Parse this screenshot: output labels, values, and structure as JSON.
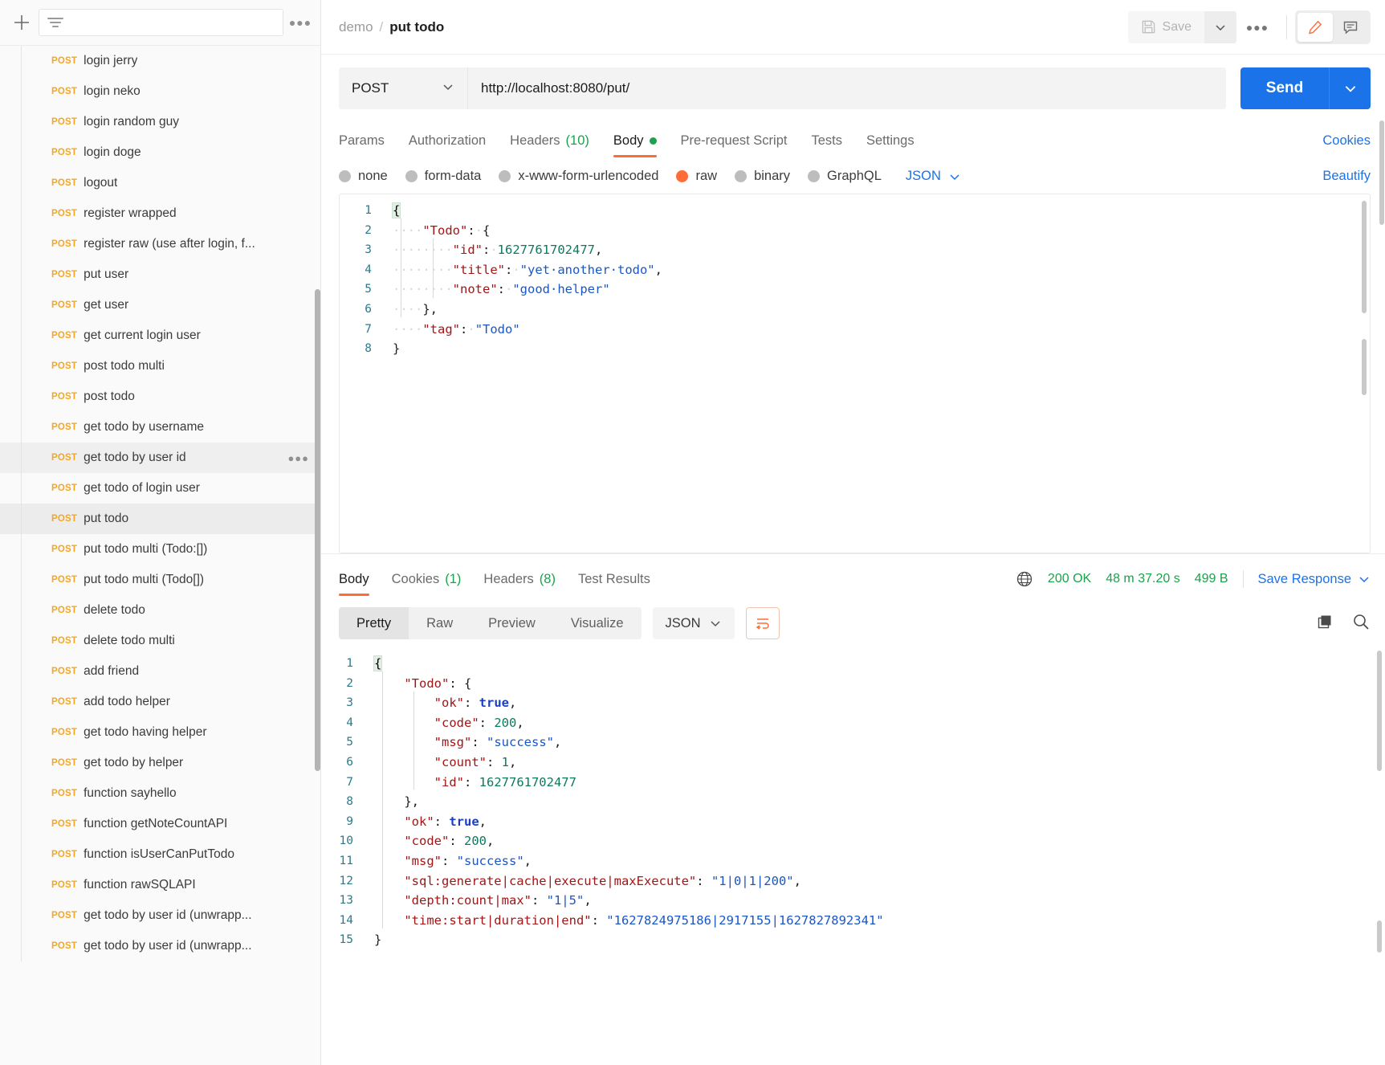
{
  "sidebar": {
    "add_label": "+",
    "filter_placeholder": "",
    "more_label": "●●●",
    "items": [
      {
        "method": "POST",
        "label": "login jerry",
        "state": "normal"
      },
      {
        "method": "POST",
        "label": "login neko",
        "state": "normal"
      },
      {
        "method": "POST",
        "label": "login random guy",
        "state": "normal"
      },
      {
        "method": "POST",
        "label": "login doge",
        "state": "normal"
      },
      {
        "method": "POST",
        "label": "logout",
        "state": "normal"
      },
      {
        "method": "POST",
        "label": "register wrapped",
        "state": "normal"
      },
      {
        "method": "POST",
        "label": "register raw (use after login, f...",
        "state": "normal"
      },
      {
        "method": "POST",
        "label": "put user",
        "state": "normal"
      },
      {
        "method": "POST",
        "label": "get user",
        "state": "normal"
      },
      {
        "method": "POST",
        "label": "get current login user",
        "state": "normal"
      },
      {
        "method": "POST",
        "label": "post todo multi",
        "state": "normal"
      },
      {
        "method": "POST",
        "label": "post todo",
        "state": "normal"
      },
      {
        "method": "POST",
        "label": "get todo by username",
        "state": "normal"
      },
      {
        "method": "POST",
        "label": "get todo by user id",
        "state": "hover"
      },
      {
        "method": "POST",
        "label": "get todo of login user",
        "state": "normal"
      },
      {
        "method": "POST",
        "label": "put todo",
        "state": "active"
      },
      {
        "method": "POST",
        "label": "put todo multi (Todo:[])",
        "state": "normal"
      },
      {
        "method": "POST",
        "label": "put todo multi (Todo[])",
        "state": "normal"
      },
      {
        "method": "POST",
        "label": "delete todo",
        "state": "normal"
      },
      {
        "method": "POST",
        "label": "delete todo multi",
        "state": "normal"
      },
      {
        "method": "POST",
        "label": "add friend",
        "state": "normal"
      },
      {
        "method": "POST",
        "label": "add todo helper",
        "state": "normal"
      },
      {
        "method": "POST",
        "label": "get todo having helper",
        "state": "normal"
      },
      {
        "method": "POST",
        "label": "get todo by helper",
        "state": "normal"
      },
      {
        "method": "POST",
        "label": "function sayhello",
        "state": "normal"
      },
      {
        "method": "POST",
        "label": "function getNoteCountAPI",
        "state": "normal"
      },
      {
        "method": "POST",
        "label": "function isUserCanPutTodo",
        "state": "normal"
      },
      {
        "method": "POST",
        "label": "function rawSQLAPI",
        "state": "normal"
      },
      {
        "method": "POST",
        "label": "get todo by user id (unwrapp...",
        "state": "normal"
      },
      {
        "method": "POST",
        "label": "get todo by user id (unwrapp...",
        "state": "normal"
      }
    ]
  },
  "header": {
    "collection": "demo",
    "separator": "/",
    "request_name": "put todo",
    "save_label": "Save",
    "more_label": "●●●"
  },
  "request": {
    "method": "POST",
    "url": "http://localhost:8080/put/",
    "send_label": "Send",
    "tabs": [
      {
        "label": "Params",
        "count": "",
        "selected": false,
        "dot": false
      },
      {
        "label": "Authorization",
        "count": "",
        "selected": false,
        "dot": false
      },
      {
        "label": "Headers",
        "count": "(10)",
        "selected": false,
        "dot": false
      },
      {
        "label": "Body",
        "count": "",
        "selected": true,
        "dot": true
      },
      {
        "label": "Pre-request Script",
        "count": "",
        "selected": false,
        "dot": false
      },
      {
        "label": "Tests",
        "count": "",
        "selected": false,
        "dot": false
      },
      {
        "label": "Settings",
        "count": "",
        "selected": false,
        "dot": false
      }
    ],
    "cookies_link": "Cookies",
    "body_types": [
      {
        "label": "none",
        "selected": false
      },
      {
        "label": "form-data",
        "selected": false
      },
      {
        "label": "x-www-form-urlencoded",
        "selected": false
      },
      {
        "label": "raw",
        "selected": true
      },
      {
        "label": "binary",
        "selected": false
      },
      {
        "label": "GraphQL",
        "selected": false
      }
    ],
    "format": "JSON",
    "beautify_label": "Beautify",
    "body_lines": [
      {
        "num": "1",
        "tokens": [
          {
            "t": "{",
            "c": "brkt-hl"
          }
        ]
      },
      {
        "num": "2",
        "tokens": [
          {
            "t": "····",
            "c": "ws"
          },
          {
            "t": "\"Todo\"",
            "c": "k"
          },
          {
            "t": ":",
            "c": "p"
          },
          {
            "t": "·",
            "c": "ws"
          },
          {
            "t": "{",
            "c": "p"
          }
        ]
      },
      {
        "num": "3",
        "tokens": [
          {
            "t": "····",
            "c": "ws"
          },
          {
            "t": "····",
            "c": "ws"
          },
          {
            "t": "\"id\"",
            "c": "k"
          },
          {
            "t": ":",
            "c": "p"
          },
          {
            "t": "·",
            "c": "ws"
          },
          {
            "t": "1627761702477",
            "c": "n"
          },
          {
            "t": ",",
            "c": "p"
          }
        ]
      },
      {
        "num": "4",
        "tokens": [
          {
            "t": "····",
            "c": "ws"
          },
          {
            "t": "····",
            "c": "ws"
          },
          {
            "t": "\"title\"",
            "c": "k"
          },
          {
            "t": ":",
            "c": "p"
          },
          {
            "t": "·",
            "c": "ws"
          },
          {
            "t": "\"yet·another·todo\"",
            "c": "s"
          },
          {
            "t": ",",
            "c": "p"
          }
        ]
      },
      {
        "num": "5",
        "tokens": [
          {
            "t": "····",
            "c": "ws"
          },
          {
            "t": "····",
            "c": "ws"
          },
          {
            "t": "\"note\"",
            "c": "k"
          },
          {
            "t": ":",
            "c": "p"
          },
          {
            "t": "·",
            "c": "ws"
          },
          {
            "t": "\"good·helper\"",
            "c": "s"
          }
        ]
      },
      {
        "num": "6",
        "tokens": [
          {
            "t": "····",
            "c": "ws"
          },
          {
            "t": "},",
            "c": "p"
          }
        ]
      },
      {
        "num": "7",
        "tokens": [
          {
            "t": "····",
            "c": "ws"
          },
          {
            "t": "\"tag\"",
            "c": "k"
          },
          {
            "t": ":",
            "c": "p"
          },
          {
            "t": "·",
            "c": "ws"
          },
          {
            "t": "\"Todo\"",
            "c": "s"
          }
        ]
      },
      {
        "num": "8",
        "tokens": [
          {
            "t": "}",
            "c": "p"
          }
        ]
      }
    ]
  },
  "response": {
    "tabs": [
      {
        "label": "Body",
        "count": "",
        "selected": true
      },
      {
        "label": "Cookies",
        "count": "(1)",
        "selected": false
      },
      {
        "label": "Headers",
        "count": "(8)",
        "selected": false
      },
      {
        "label": "Test Results",
        "count": "",
        "selected": false
      }
    ],
    "status": "200 OK",
    "time": "48 m 37.20 s",
    "size": "499 B",
    "save_response_label": "Save Response",
    "view_segments": [
      {
        "label": "Pretty",
        "selected": true
      },
      {
        "label": "Raw",
        "selected": false
      },
      {
        "label": "Preview",
        "selected": false
      },
      {
        "label": "Visualize",
        "selected": false
      }
    ],
    "format": "JSON",
    "body_lines": [
      {
        "num": "1",
        "tokens": [
          {
            "t": "{",
            "c": "brkt-hl"
          }
        ]
      },
      {
        "num": "2",
        "tokens": [
          {
            "t": "    ",
            "c": "p"
          },
          {
            "t": "\"Todo\"",
            "c": "k"
          },
          {
            "t": ": {",
            "c": "p"
          }
        ]
      },
      {
        "num": "3",
        "tokens": [
          {
            "t": "        ",
            "c": "p"
          },
          {
            "t": "\"ok\"",
            "c": "k"
          },
          {
            "t": ": ",
            "c": "p"
          },
          {
            "t": "true",
            "c": "b"
          },
          {
            "t": ",",
            "c": "p"
          }
        ]
      },
      {
        "num": "4",
        "tokens": [
          {
            "t": "        ",
            "c": "p"
          },
          {
            "t": "\"code\"",
            "c": "k"
          },
          {
            "t": ": ",
            "c": "p"
          },
          {
            "t": "200",
            "c": "n"
          },
          {
            "t": ",",
            "c": "p"
          }
        ]
      },
      {
        "num": "5",
        "tokens": [
          {
            "t": "        ",
            "c": "p"
          },
          {
            "t": "\"msg\"",
            "c": "k"
          },
          {
            "t": ": ",
            "c": "p"
          },
          {
            "t": "\"success\"",
            "c": "s"
          },
          {
            "t": ",",
            "c": "p"
          }
        ]
      },
      {
        "num": "6",
        "tokens": [
          {
            "t": "        ",
            "c": "p"
          },
          {
            "t": "\"count\"",
            "c": "k"
          },
          {
            "t": ": ",
            "c": "p"
          },
          {
            "t": "1",
            "c": "n"
          },
          {
            "t": ",",
            "c": "p"
          }
        ]
      },
      {
        "num": "7",
        "tokens": [
          {
            "t": "        ",
            "c": "p"
          },
          {
            "t": "\"id\"",
            "c": "k"
          },
          {
            "t": ": ",
            "c": "p"
          },
          {
            "t": "1627761702477",
            "c": "n"
          }
        ]
      },
      {
        "num": "8",
        "tokens": [
          {
            "t": "    ",
            "c": "p"
          },
          {
            "t": "},",
            "c": "p"
          }
        ]
      },
      {
        "num": "9",
        "tokens": [
          {
            "t": "    ",
            "c": "p"
          },
          {
            "t": "\"ok\"",
            "c": "k"
          },
          {
            "t": ": ",
            "c": "p"
          },
          {
            "t": "true",
            "c": "b"
          },
          {
            "t": ",",
            "c": "p"
          }
        ]
      },
      {
        "num": "10",
        "tokens": [
          {
            "t": "    ",
            "c": "p"
          },
          {
            "t": "\"code\"",
            "c": "k"
          },
          {
            "t": ": ",
            "c": "p"
          },
          {
            "t": "200",
            "c": "n"
          },
          {
            "t": ",",
            "c": "p"
          }
        ]
      },
      {
        "num": "11",
        "tokens": [
          {
            "t": "    ",
            "c": "p"
          },
          {
            "t": "\"msg\"",
            "c": "k"
          },
          {
            "t": ": ",
            "c": "p"
          },
          {
            "t": "\"success\"",
            "c": "s"
          },
          {
            "t": ",",
            "c": "p"
          }
        ]
      },
      {
        "num": "12",
        "tokens": [
          {
            "t": "    ",
            "c": "p"
          },
          {
            "t": "\"sql:generate|cache|execute|maxExecute\"",
            "c": "k"
          },
          {
            "t": ": ",
            "c": "p"
          },
          {
            "t": "\"1|0|1|200\"",
            "c": "s"
          },
          {
            "t": ",",
            "c": "p"
          }
        ]
      },
      {
        "num": "13",
        "tokens": [
          {
            "t": "    ",
            "c": "p"
          },
          {
            "t": "\"depth:count|max\"",
            "c": "k"
          },
          {
            "t": ": ",
            "c": "p"
          },
          {
            "t": "\"1|5\"",
            "c": "s"
          },
          {
            "t": ",",
            "c": "p"
          }
        ]
      },
      {
        "num": "14",
        "tokens": [
          {
            "t": "    ",
            "c": "p"
          },
          {
            "t": "\"time:start|duration|end\"",
            "c": "k"
          },
          {
            "t": ": ",
            "c": "p"
          },
          {
            "t": "\"1627824975186|2917155|1627827892341\"",
            "c": "s"
          }
        ]
      },
      {
        "num": "15",
        "tokens": [
          {
            "t": "}",
            "c": "p"
          }
        ]
      }
    ]
  },
  "colors": {
    "accent": "#ff6c37",
    "send": "#1a73e8",
    "method": "#f5a623",
    "ok": "#1aa34a",
    "link": "#1a73e8"
  }
}
